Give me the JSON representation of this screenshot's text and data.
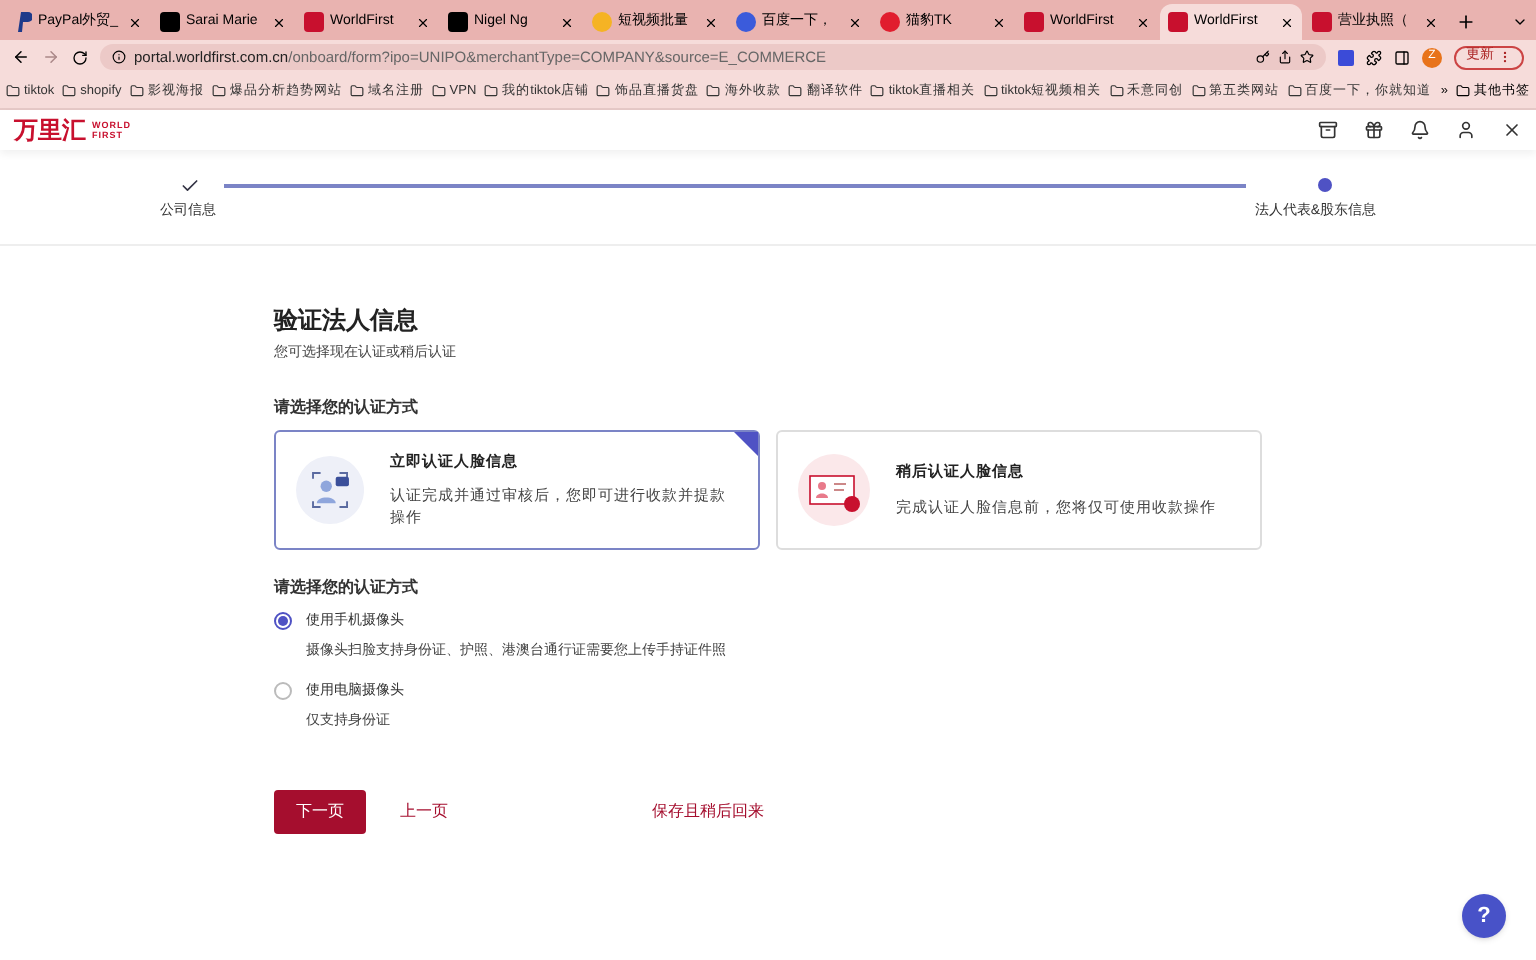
{
  "browser": {
    "tabs": [
      {
        "title": "PayPal外贸_",
        "selected": false
      },
      {
        "title": "Sarai Marie",
        "selected": false
      },
      {
        "title": "WorldFirst",
        "selected": false
      },
      {
        "title": "Nigel Ng",
        "selected": false
      },
      {
        "title": "短视频批量",
        "selected": false
      },
      {
        "title": "百度一下，",
        "selected": false
      },
      {
        "title": "猫豹TK",
        "selected": false
      },
      {
        "title": "WorldFirst",
        "selected": false
      },
      {
        "title": "WorldFirst",
        "selected": true
      },
      {
        "title": "营业执照（",
        "selected": false
      }
    ],
    "url_host": "portal.worldfirst.com.cn",
    "url_path": "/onboard/form?ipo=UNIPO&merchantType=COMPANY&source=E_COMMERCE",
    "profile_initial": "Z",
    "update_button": "更新",
    "bookmarks": [
      "tiktok",
      "shopify",
      "影视海报",
      "爆品分析趋势网站",
      "域名注册",
      "VPN",
      "我的tiktok店铺",
      "饰品直播货盘",
      "海外收款",
      "翻译软件",
      "tiktok直播相关",
      "tiktok短视频相关",
      "禾意同创",
      "第五类网站",
      "百度一下，你就知道"
    ],
    "more_bookmarks": "»",
    "other_bookmarks": "其他书签"
  },
  "header": {
    "logo_cn": "万里汇",
    "logo_en_1": "WORLD",
    "logo_en_2": "FIRST"
  },
  "steps": [
    {
      "label": "公司信息",
      "done": true
    },
    {
      "label": "法人代表&股东信息",
      "done": false
    }
  ],
  "form": {
    "title": "验证法人信息",
    "subtitle": "您可选择现在认证或稍后认证",
    "method_heading": "请选择您的认证方式",
    "method_cards": [
      {
        "kind": "now",
        "title": "立即认证人脸信息",
        "desc": "认证完成并通过审核后，您即可进行收款并提款操作",
        "selected": true
      },
      {
        "kind": "later",
        "title": "稍后认证人脸信息",
        "desc": "完成认证人脸信息前，您将仅可使用收款操作",
        "selected": false
      }
    ],
    "camera_heading": "请选择您的认证方式",
    "camera_options": [
      {
        "label": "使用手机摄像头",
        "desc": "摄像头扫脸支持身份证、护照、港澳台通行证需要您上传手持证件照",
        "selected": true
      },
      {
        "label": "使用电脑摄像头",
        "desc": "仅支持身份证",
        "selected": false
      }
    ],
    "next_button": "下一页",
    "prev_link": "上一页",
    "save_link": "保存且稍后回来"
  },
  "help_button": "?"
}
